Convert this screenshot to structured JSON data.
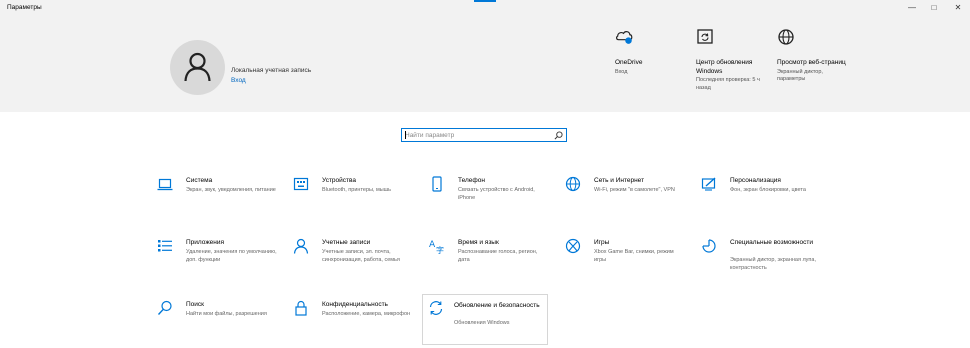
{
  "window": {
    "title": "Параметры",
    "controls": {
      "minimize": "—",
      "maximize": "□",
      "close": "✕"
    }
  },
  "account": {
    "name": "Локальная учетная запись",
    "link": "Вход",
    "icon": "user-icon"
  },
  "quick": [
    {
      "id": "onedrive",
      "title": "OneDrive",
      "subtitle": "Вход",
      "icon": "cloud-icon"
    },
    {
      "id": "update",
      "title": "Центр обновления Windows",
      "subtitle": "Последняя проверка: 5 ч назад",
      "icon": "update-icon"
    },
    {
      "id": "browser",
      "title": "Просмотр веб-страниц",
      "subtitle": "Экранный диктор, параметры",
      "icon": "globe-icon"
    }
  ],
  "search": {
    "placeholder": "Найти параметр",
    "icon": "search-icon"
  },
  "tiles": [
    {
      "id": "system",
      "title": "Система",
      "desc": "Экран, звук, уведомления, питание",
      "icon": "laptop-icon"
    },
    {
      "id": "devices",
      "title": "Устройства",
      "desc": "Bluetooth, принтеры, мышь",
      "icon": "keyboard-icon"
    },
    {
      "id": "phone",
      "title": "Телефон",
      "desc": "Связать устройство с Android, iPhone",
      "icon": "phone-icon"
    },
    {
      "id": "network",
      "title": "Сеть и Интернет",
      "desc": "Wi-Fi, режим \"в самолете\", VPN",
      "icon": "globe-icon"
    },
    {
      "id": "personalization",
      "title": "Персонализация",
      "desc": "Фон, экран блокировки, цвета",
      "icon": "brush-icon"
    },
    {
      "id": "apps",
      "title": "Приложения",
      "desc": "Удаление, значения по умолчанию, доп. функции",
      "icon": "apps-list-icon"
    },
    {
      "id": "accounts",
      "title": "Учетные записи",
      "desc": "Учетные записи, эл. почта, синхронизация, работа, семья",
      "icon": "person-icon"
    },
    {
      "id": "time",
      "title": "Время и язык",
      "desc": "Распознавание голоса, регион, дата",
      "icon": "language-icon"
    },
    {
      "id": "games",
      "title": "Игры",
      "desc": "Xbox Game Bar, снимки, режим игры",
      "icon": "xbox-icon"
    },
    {
      "id": "ease",
      "title": "Специальные возможности",
      "desc": "Экранный диктор, экранная лупа, контрастность",
      "icon": "ease-of-access-icon"
    },
    {
      "id": "search",
      "title": "Поиск",
      "desc": "Найти мои файлы, разрешения",
      "icon": "search-icon"
    },
    {
      "id": "privacy",
      "title": "Конфиденциальность",
      "desc": "Расположение, камера, микрофон",
      "icon": "lock-icon"
    },
    {
      "id": "update-security",
      "title": "Обновление и безопасность",
      "desc": "Обновления Windows",
      "icon": "sync-icon"
    }
  ],
  "colors": {
    "accent": "#0078d7",
    "header_bg": "#f2f2f2",
    "link": "#0067c0"
  }
}
